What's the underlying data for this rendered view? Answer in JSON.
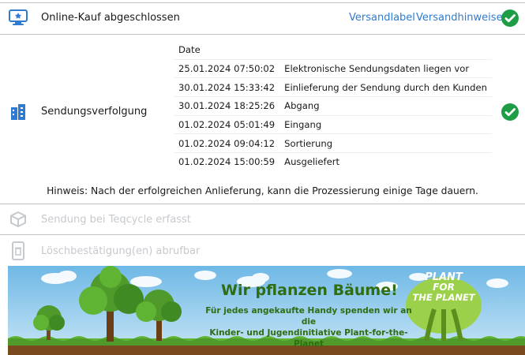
{
  "steps": {
    "online": {
      "title": "Online-Kauf abgeschlossen",
      "links": [
        "Versandlabel",
        "Versandhinweise"
      ],
      "status": "complete"
    },
    "tracking": {
      "title": "Sendungsverfolgung",
      "status": "complete",
      "table": {
        "header": "Date",
        "rows": [
          [
            "25.01.2024 07:50:02",
            "Elektronische Sendungsdaten liegen vor"
          ],
          [
            "30.01.2024 15:33:42",
            "Einlieferung der Sendung durch den Kunden"
          ],
          [
            "30.01.2024 18:25:26",
            "Abgang"
          ],
          [
            "01.02.2024 05:01:49",
            "Eingang"
          ],
          [
            "01.02.2024 09:04:12",
            "Sortierung"
          ],
          [
            "01.02.2024 15:00:59",
            "Ausgeliefert"
          ]
        ]
      },
      "note": "Hinweis: Nach der erfolgreichen Anlieferung, kann die Prozessierung einige Tage dauern."
    },
    "registered": {
      "title": "Sendung bei Teqcycle erfasst",
      "status": "pending"
    },
    "deletion": {
      "title": "Löschbestätigung(en) abrufbar",
      "status": "pending"
    }
  },
  "banner": {
    "headline": "Wir pflanzen Bäume!",
    "text_line1": "Für jedes angekaufte Handy spenden wir an die",
    "text_line2": "Kinder- und Jugendinitiative Plant-for-the-Planet",
    "logo_lines": [
      "PLANT",
      "FOR",
      "THE PLANET"
    ]
  },
  "colors": {
    "accent": "#2e7bd1",
    "success": "#1e9d47",
    "muted": "#c6c9cd",
    "rule": "#bfc3c8"
  },
  "icons": [
    "monitor-cart-icon",
    "checkmark-icon",
    "building-icon",
    "box-icon",
    "phone-delete-icon"
  ]
}
